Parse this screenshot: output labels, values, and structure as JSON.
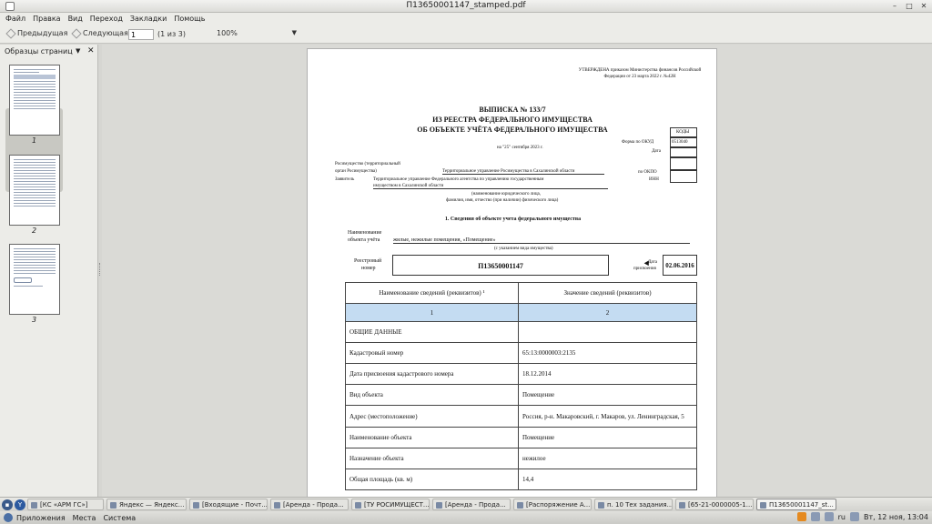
{
  "window": {
    "title": "П13650001147_stamped.pdf"
  },
  "menu": [
    "Файл",
    "Правка",
    "Вид",
    "Переход",
    "Закладки",
    "Помощь"
  ],
  "toolbar": {
    "prev_label": "Предыдущая",
    "next_label": "Следующая",
    "page_value": "1",
    "page_of": "(1 из 3)",
    "zoom": "100%"
  },
  "sidebar": {
    "title": "Образцы страниц",
    "thumbs": [
      "1",
      "2",
      "3"
    ]
  },
  "doc": {
    "approved": "УТВЕРЖДЕНА приказом Министерства финансов Российской Федерации от 23 марта 2022 г. №42Н",
    "title1": "ВЫПИСКА № 133/7",
    "title2": "ИЗ РЕЕСТРА ФЕДЕРАЛЬНОГО ИМУЩЕСТВА",
    "title3": "ОБ ОБЪЕКТЕ УЧЁТА ФЕДЕРАЛЬНОГО ИМУЩЕСТВА",
    "date": "на \"25\" сентября 2023 г.",
    "codes_header": "КОДЫ",
    "okud_label": "Форма по ОКУД",
    "okud_value": "0513040",
    "date_label": "Дата",
    "okpo_label": "по ОКПО",
    "inn_label": "ИНН",
    "rosim_label1": "Росимущество (территориальный",
    "rosim_label2": "орган Росимущества)",
    "rosim_value": "Территориальное управление Росимущества в Сахалинской области",
    "applicant_label": "Заявитель",
    "applicant_value1": "Территориальное управление Федерального агентства по управлению государственным",
    "applicant_value2": "имуществом в Сахалинской области",
    "applicant_note1": "(наименование юридического лица,",
    "applicant_note2": "фамилия, имя, отчество (при наличии) физического лица)",
    "section1": "1. Сведения об объекте учета федерального имущества",
    "obj_label1": "Наименование",
    "obj_label2": "объекта учёта",
    "obj_value": "жилые, нежилые помещения, «Помещение»",
    "obj_note": "(с указанием вида имущества)",
    "reg_label1": "Реестровый",
    "reg_label2": "номер",
    "reg_number": "П13650001147",
    "assign_label1": "Дата",
    "assign_label2": "присвоения",
    "assign_date": "02.06.2016",
    "table_head": [
      "Наименование сведений (реквизитов) ¹",
      "Значение сведений (реквизитов)"
    ],
    "table_nums": [
      "1",
      "2"
    ],
    "rows": [
      [
        "ОБЩИЕ ДАННЫЕ",
        ""
      ],
      [
        "Кадастровый номер",
        "65:13:0000003:2135"
      ],
      [
        "Дата присвоения кадастрового номера",
        "18.12.2014"
      ],
      [
        "Вид объекта",
        "Помещение"
      ],
      [
        "Адрес (местоположение)",
        "Россия, р-н. Макаровский, г. Макаров, ул. Ленинградская, 5"
      ],
      [
        "Наименование объекта",
        "Помещение"
      ],
      [
        "Назначение объекта",
        "нежилое"
      ],
      [
        "Общая площадь (кв. м)",
        "14,4"
      ]
    ]
  },
  "taskbar": {
    "items": [
      "[КС «АРМ ГС»]",
      "Яндекс — Яндекс...",
      "[Входящие - Почт...",
      "[Аренда - Прода...",
      "[ТУ РОСИМУЩЕСТ...",
      "[Аренда - Прода...",
      "[Распоряжение А...",
      "п. 10 Тех задания...",
      "[65-21-0000005-1...",
      "П13650001147_st..."
    ]
  },
  "panel": {
    "apps": "Приложения",
    "places": "Места",
    "system": "Система",
    "lang": "ru",
    "clock": "Вт, 12 ноя, 13:04"
  }
}
